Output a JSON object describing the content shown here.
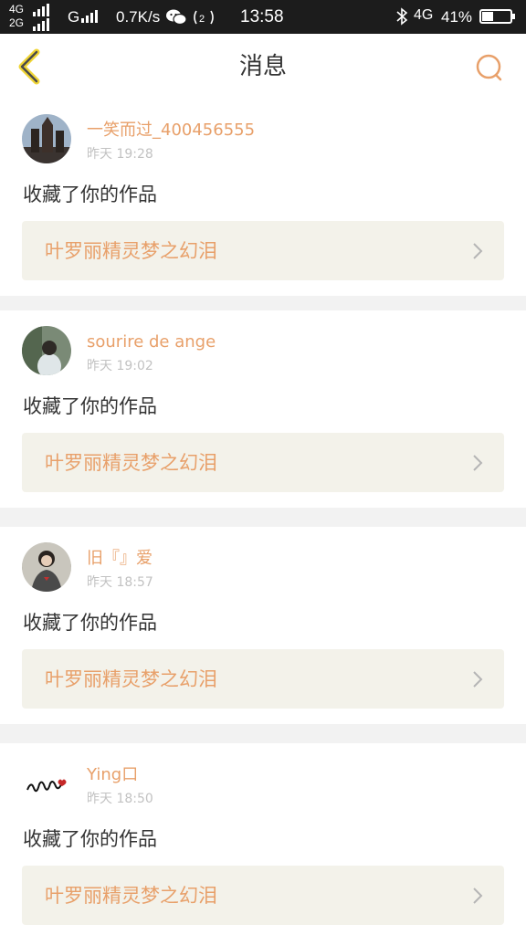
{
  "status_bar": {
    "network_top": "4G",
    "network_bottom": "2G",
    "network_g": "G",
    "speed": "0.7K/s",
    "time": "13:58",
    "network_right": "4G",
    "battery": "41%",
    "battery_level": 0.41
  },
  "header": {
    "title": "消息",
    "back_icon": "chevron-left-icon",
    "search_icon": "search-icon",
    "accent_color": "#e8a06a"
  },
  "messages": [
    {
      "username": "一笑而过_400456555",
      "time": "昨天 19:28",
      "action": "收藏了你的作品",
      "work_title": "叶罗丽精灵梦之幻泪"
    },
    {
      "username": "sourire de ange",
      "time": "昨天 19:02",
      "action": "收藏了你的作品",
      "work_title": "叶罗丽精灵梦之幻泪"
    },
    {
      "username": "旧『』爱",
      "time": "昨天 18:57",
      "action": "收藏了你的作品",
      "work_title": "叶罗丽精灵梦之幻泪"
    },
    {
      "username": "Ying口",
      "time": "昨天 18:50",
      "action": "收藏了你的作品",
      "work_title": "叶罗丽精灵梦之幻泪"
    }
  ]
}
